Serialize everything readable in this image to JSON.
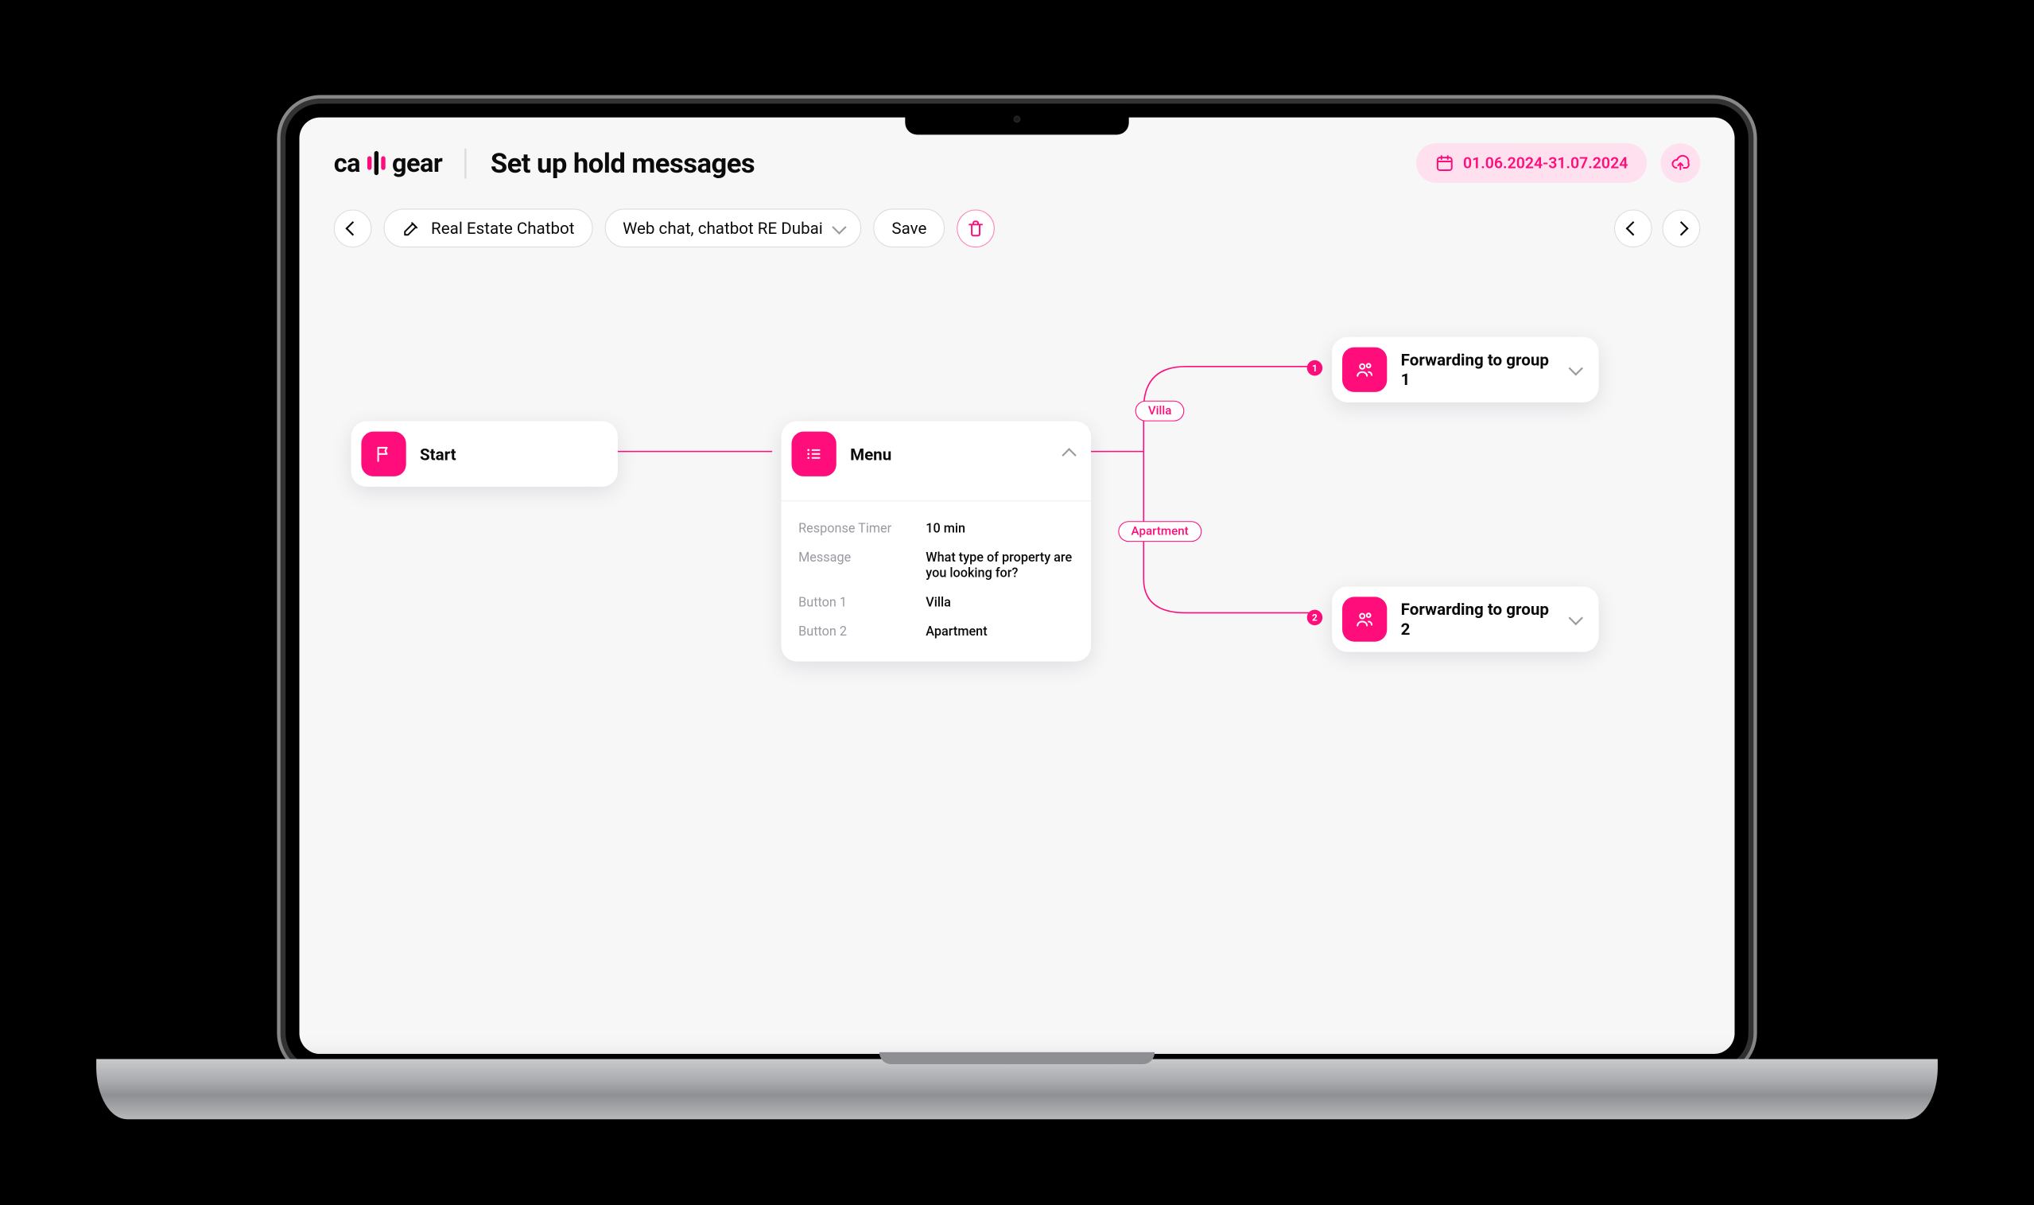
{
  "header": {
    "logo_left": "ca",
    "logo_right": "gear",
    "page_title": "Set up hold messages",
    "date_range": "01.06.2024-31.07.2024"
  },
  "toolbar": {
    "chatbot_name": "Real Estate Chatbot",
    "channel_name": "Web chat, chatbot RE Dubai",
    "save_label": "Save"
  },
  "flow": {
    "start": {
      "label": "Start"
    },
    "menu": {
      "label": "Menu",
      "rows": {
        "response_timer_key": "Response Timer",
        "response_timer_val": "10 min",
        "message_key": "Message",
        "message_val": "What type of property are you looking for?",
        "button1_key": "Button 1",
        "button1_val": "Villa",
        "button2_key": "Button 2",
        "button2_val": "Apartment"
      }
    },
    "edge_labels": {
      "villa": "Villa",
      "apartment": "Apartment"
    },
    "badges": {
      "one": "1",
      "two": "2"
    },
    "group1": {
      "label": "Forwarding to group 1"
    },
    "group2": {
      "label": "Forwarding to group 2"
    }
  }
}
